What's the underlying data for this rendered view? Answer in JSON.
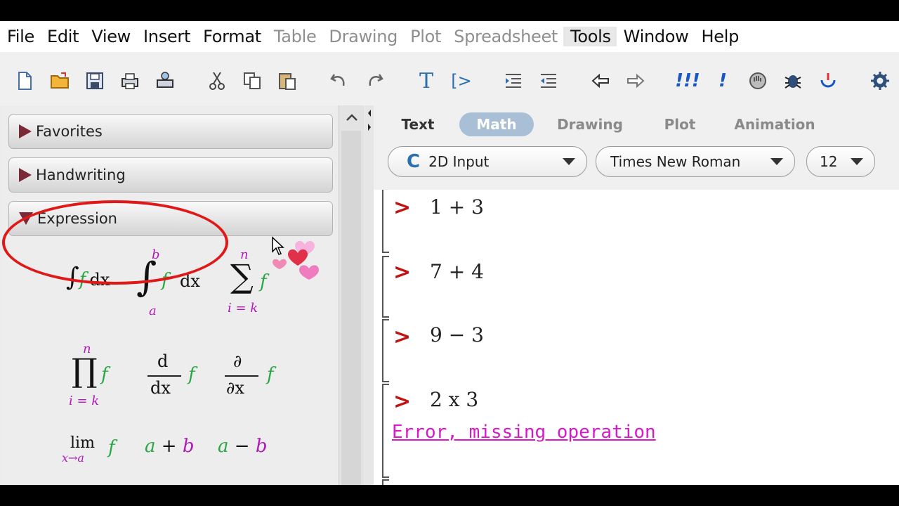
{
  "menu": [
    {
      "label": "File",
      "enabled": true
    },
    {
      "label": "Edit",
      "enabled": true
    },
    {
      "label": "View",
      "enabled": true
    },
    {
      "label": "Insert",
      "enabled": true
    },
    {
      "label": "Format",
      "enabled": true
    },
    {
      "label": "Table",
      "enabled": false
    },
    {
      "label": "Drawing",
      "enabled": false
    },
    {
      "label": "Plot",
      "enabled": false
    },
    {
      "label": "Spreadsheet",
      "enabled": false
    },
    {
      "label": "Tools",
      "enabled": true
    },
    {
      "label": "Window",
      "enabled": true
    },
    {
      "label": "Help",
      "enabled": true
    }
  ],
  "toolbar": {
    "icons": [
      "new-document-icon",
      "open-folder-icon",
      "save-icon",
      "print-icon",
      "print-preview-icon",
      "cut-icon",
      "copy-icon",
      "paste-icon",
      "undo-icon",
      "redo-icon",
      "text-mode-icon",
      "math-prompt-icon",
      "indent-icon",
      "outdent-icon",
      "back-arrow-icon",
      "forward-arrow-icon",
      "execute-all-icon",
      "execute-icon",
      "stop-icon",
      "debug-icon",
      "restart-icon",
      "settings-icon"
    ],
    "text_mode_glyph": "T",
    "prompt_glyph": "[>",
    "execute_all_glyph": "!!!",
    "execute_glyph": "!"
  },
  "palette": {
    "sections": [
      {
        "label": "Favorites",
        "expanded": false
      },
      {
        "label": "Handwriting",
        "expanded": false
      },
      {
        "label": "Expression",
        "expanded": true
      }
    ],
    "expressions": {
      "integral": {
        "sign": "∫",
        "f": "f",
        "dx": "dx"
      },
      "def_integral": {
        "sign": "∫",
        "upper": "b",
        "lower": "a",
        "f": "f",
        "dx": "dx"
      },
      "sum": {
        "sign": "∑",
        "upper": "n",
        "lower": "i = k",
        "f": "f"
      },
      "product": {
        "sign": "∏",
        "upper": "n",
        "lower": "i = k",
        "f": "f"
      },
      "derivative": {
        "num": "d",
        "den": "dx",
        "f": "f"
      },
      "partial": {
        "num": "∂",
        "den": "∂x",
        "f": "f"
      },
      "limit": {
        "lim": "lim",
        "sub": "x→a",
        "f": "f"
      },
      "add": {
        "a": "a",
        "op": "+",
        "b": "b"
      },
      "subtract": {
        "a": "a",
        "op": "−",
        "b": "b"
      }
    }
  },
  "document": {
    "tabs": [
      {
        "label": "Text",
        "active": false
      },
      {
        "label": "Math",
        "active": true
      },
      {
        "label": "Drawing",
        "active": false
      },
      {
        "label": "Plot",
        "active": false
      },
      {
        "label": "Animation",
        "active": false
      }
    ],
    "input_mode": {
      "icon_glyph": "C",
      "value": "2D Input"
    },
    "font": "Times New Roman",
    "font_size": "12",
    "prompt_symbol": ">",
    "entries": [
      {
        "input": "1 + 3"
      },
      {
        "input": "7 + 4"
      },
      {
        "input": "9 − 3"
      },
      {
        "input": "2 x 3",
        "error": "Error, missing operation"
      }
    ]
  },
  "colors": {
    "prompt": "#c01414",
    "error": "#d61ac8",
    "active_tab": "#a9bfd6",
    "palette_arrow": "#7a2a35",
    "annotation_circle": "#e01818"
  }
}
